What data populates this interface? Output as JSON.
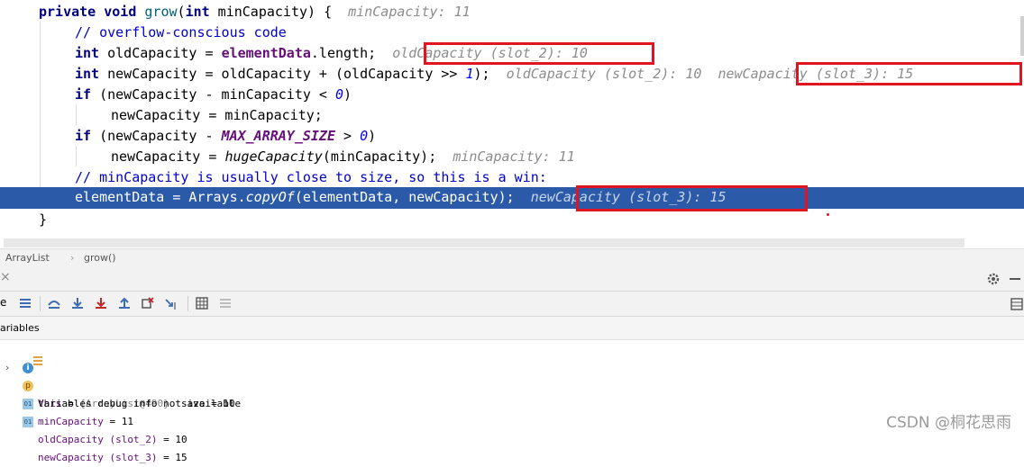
{
  "code": {
    "l1": {
      "kw1": "private",
      "kw2": "void",
      "fn": "grow",
      "p1": "(",
      "kw3": "int",
      "p2": " minCapacity) {",
      "hint": "minCapacity: 11"
    },
    "l2": {
      "cmt": "// overflow-conscious code"
    },
    "l3": {
      "kw": "int",
      "p1": " oldCapacity = ",
      "field": "elementData",
      "p2": ".length;",
      "hint": "oldCapacity (slot_2): 10"
    },
    "l4": {
      "kw": "int",
      "p1": " newCapacity = oldCapacity + (oldCapacity >> ",
      "num": "1",
      "p2": ");",
      "hint1": "oldCapacity (slot_2): 10",
      "hint2": "newCapacity (slot_3): 15"
    },
    "l5": {
      "kw": "if",
      "p1": " (newCapacity - minCapacity < ",
      "num": "0",
      "p2": ")"
    },
    "l6": {
      "p1": "newCapacity = minCapacity;"
    },
    "l7": {
      "kw": "if",
      "p1": " (newCapacity - ",
      "const": "MAX_ARRAY_SIZE",
      "p2": " > ",
      "num": "0",
      "p3": ")"
    },
    "l8": {
      "p1": "newCapacity = ",
      "fn": "hugeCapacity",
      "p2": "(minCapacity);",
      "hint": "minCapacity: 11"
    },
    "l9": {
      "cmt": "// minCapacity is usually close to size, so this is a win:"
    },
    "l10": {
      "p1": "elementData = Arrays.",
      "fn": "copyOf",
      "p2": "(elementData, newCapacity);",
      "hint": "newCapacity (slot_3): 15"
    },
    "l11": {
      "p1": "}"
    }
  },
  "breadcrumb": {
    "class": "ArrayList",
    "sep": "›",
    "method": "grow()"
  },
  "panel": {
    "close": "×",
    "settings_icon": "gear-icon",
    "minimize": "—"
  },
  "toolbar": {
    "left_label": "e",
    "icons": [
      "threads-icon",
      "show-execution-point-icon",
      "step-over-icon",
      "step-into-icon",
      "force-step-into-icon",
      "step-out-icon",
      "drop-frame-icon",
      "run-to-cursor-icon",
      "evaluate-icon",
      "trace-icon"
    ]
  },
  "variables": {
    "header": "ariables",
    "rows": [
      {
        "expander": "›",
        "icon": "field-icon",
        "name": "this",
        "eq": " = ",
        "value": "{ArrayList@490}",
        "extra": "  size = 10"
      },
      {
        "icon": "info-icon",
        "text": "Variables debug info not available"
      },
      {
        "icon": "param-icon",
        "icon_label": "p",
        "name": "minCapacity",
        "eq": " = ",
        "value": "11"
      },
      {
        "icon": "local-icon",
        "icon_label": "01",
        "name": "oldCapacity (slot_2)",
        "eq": " = ",
        "value": "10"
      },
      {
        "icon": "local-icon",
        "icon_label": "01",
        "name": "newCapacity (slot_3)",
        "eq": " = ",
        "value": "15"
      }
    ]
  },
  "watermark": "CSDN @桐花思雨",
  "colors": {
    "highlight": "#2a5aa8",
    "annotation_box": "#e0151f"
  }
}
